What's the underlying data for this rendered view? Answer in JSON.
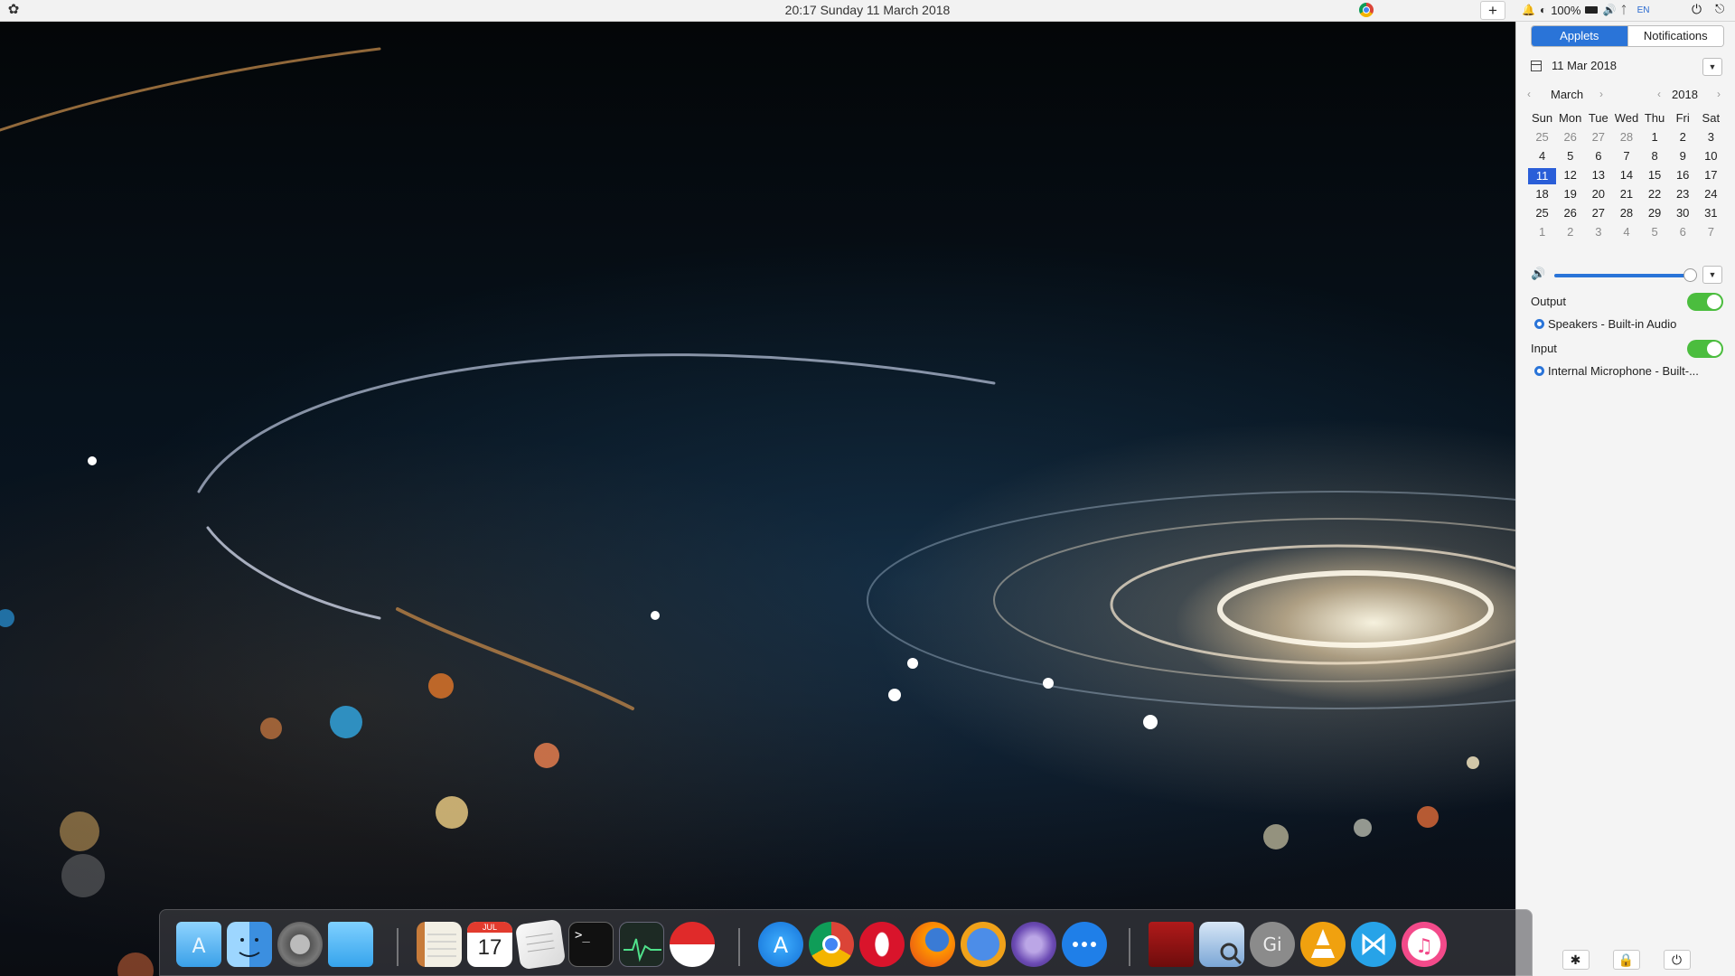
{
  "topbar": {
    "clock": "20:17  Sunday 11 March 2018",
    "battery_percent": "100%",
    "language": "EN",
    "add_label": "+"
  },
  "panel": {
    "tabs": [
      {
        "label": "Applets",
        "active": true
      },
      {
        "label": "Notifications",
        "active": false
      }
    ],
    "date_display": "11 Mar 2018",
    "calendar": {
      "month": "March",
      "year": "2018",
      "weekdays": [
        "Sun",
        "Mon",
        "Tue",
        "Wed",
        "Thu",
        "Fri",
        "Sat"
      ],
      "weeks": [
        [
          "25",
          "26",
          "27",
          "28",
          "1",
          "2",
          "3"
        ],
        [
          "4",
          "5",
          "6",
          "7",
          "8",
          "9",
          "10"
        ],
        [
          "11",
          "12",
          "13",
          "14",
          "15",
          "16",
          "17"
        ],
        [
          "18",
          "19",
          "20",
          "21",
          "22",
          "23",
          "24"
        ],
        [
          "25",
          "26",
          "27",
          "28",
          "29",
          "30",
          "31"
        ],
        [
          "1",
          "2",
          "3",
          "4",
          "5",
          "6",
          "7"
        ]
      ],
      "selected_day": "11"
    },
    "volume_level": 0.95,
    "output_label": "Output",
    "output_enabled": true,
    "output_device": "Speakers - Built-in Audio",
    "input_label": "Input",
    "input_enabled": true,
    "input_device": "Internal Microphone - Built-..."
  },
  "dock": {
    "icons": [
      "app-store-folder-icon",
      "finder-icon",
      "system-preferences-icon",
      "folder-icon",
      "notes-icon",
      "calendar-icon",
      "text-editor-icon",
      "terminal-icon",
      "activity-monitor-icon",
      "record-icon",
      "app-store-icon",
      "chrome-icon",
      "opera-icon",
      "firefox-icon",
      "safari-like-browser-icon",
      "tor-browser-icon",
      "messages-icon",
      "photo-booth-icon",
      "preview-icon",
      "gimp-icon",
      "vlc-icon",
      "vscode-icon",
      "itunes-icon"
    ],
    "calendar_icon": {
      "month": "JUL",
      "day": "17"
    },
    "terminal_prompt": ">_"
  }
}
